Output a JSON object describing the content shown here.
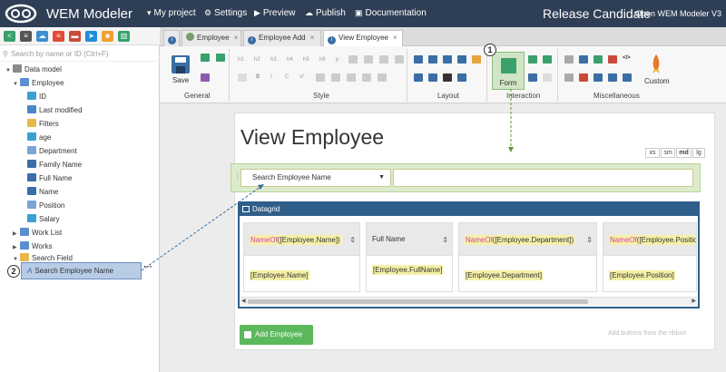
{
  "topbar": {
    "brand": "WEM Modeler",
    "menu": [
      {
        "label": "My project",
        "icon": "caret-down-icon",
        "glyph": "▾"
      },
      {
        "label": "Settings",
        "icon": "gear-icon",
        "glyph": "⚙"
      },
      {
        "label": "Preview",
        "icon": "play-icon",
        "glyph": "▶"
      },
      {
        "label": "Publish",
        "icon": "cloud-upload-icon",
        "glyph": "☁"
      },
      {
        "label": "Documentation",
        "icon": "book-icon",
        "glyph": "▣"
      }
    ],
    "release": "Release Candidate",
    "version": "Open WEM Modeler V3"
  },
  "sidebar": {
    "search_placeholder": "Search by name or ID (Ctrl+F)",
    "tree": [
      {
        "label": "Data model",
        "arrow": "▼",
        "icon": "database-icon",
        "color": "#8a8a8a"
      },
      {
        "label": "Employee",
        "arrow": "▼",
        "icon": "table-icon",
        "color": "#5a8ed0"
      },
      {
        "label": "ID",
        "icon": "number-field-icon",
        "color": "#3b9fd4"
      },
      {
        "label": "Last modified",
        "icon": "date-field-icon",
        "color": "#4a86c5"
      },
      {
        "label": "Filters",
        "icon": "folder-icon",
        "color": "#e6b84a"
      },
      {
        "label": "age",
        "icon": "number-field-icon",
        "color": "#3b9fd4"
      },
      {
        "label": "Department",
        "icon": "reference-field-icon",
        "color": "#7aa5d6"
      },
      {
        "label": "Family Name",
        "icon": "text-field-icon",
        "color": "#3a6ea5"
      },
      {
        "label": "Full Name",
        "icon": "text-field-icon",
        "color": "#3a6ea5"
      },
      {
        "label": "Name",
        "icon": "text-field-icon",
        "color": "#3a6ea5"
      },
      {
        "label": "Position",
        "icon": "reference-field-icon",
        "color": "#7aa5d6"
      },
      {
        "label": "Salary",
        "icon": "number-field-icon",
        "color": "#3b9fd4"
      },
      {
        "label": "Work List",
        "arrow": "▶",
        "icon": "list-icon",
        "color": "#5a8ed0"
      },
      {
        "label": "Works",
        "arrow": "▶",
        "icon": "list-icon",
        "color": "#5a8ed0"
      },
      {
        "label": "Search Field",
        "arrow": "▼",
        "icon": "folder-icon",
        "color": "#e6b84a"
      }
    ],
    "selected": "Search Employee Name",
    "more": "···"
  },
  "tabs": [
    {
      "label": "",
      "icon": "info-icon"
    },
    {
      "label": "Employee",
      "icon": "flowchart-icon"
    },
    {
      "label": "Employee Add",
      "icon": "form-icon"
    },
    {
      "label": "View Employee",
      "icon": "form-icon",
      "active": true
    }
  ],
  "ribbon": {
    "groups": [
      "General",
      "Style",
      "Layout",
      "Interaction",
      "Miscellaneous"
    ],
    "save": "Save",
    "form": "Form",
    "custom": "Custom",
    "style_small": [
      "h1",
      "h2",
      "h3",
      "h4",
      "h5",
      "h6",
      "p"
    ]
  },
  "callouts": [
    "1",
    "2"
  ],
  "page": {
    "title": "View Employee",
    "breakpoints": [
      "xs",
      "sm",
      "md",
      "lg"
    ],
    "search_field": {
      "label": "Search Employee Name",
      "caret": "▼"
    },
    "datagrid": {
      "title": "Datagrid",
      "columns": [
        {
          "func": "NameOf",
          "header": "([Employee.Name])",
          "cell": "[Employee.Name]"
        },
        {
          "func": "",
          "header": "Full Name",
          "cell": "[Employee.FullName]"
        },
        {
          "func": "NameOf",
          "header": "([Employee.Department])",
          "cell": "[Employee.Department]"
        },
        {
          "func": "NameOf",
          "header": "([Employee.Position",
          "cell": "[Employee.Position]"
        }
      ]
    },
    "add_button": "Add Employee",
    "hint": "Add buttons from the ribbon"
  }
}
